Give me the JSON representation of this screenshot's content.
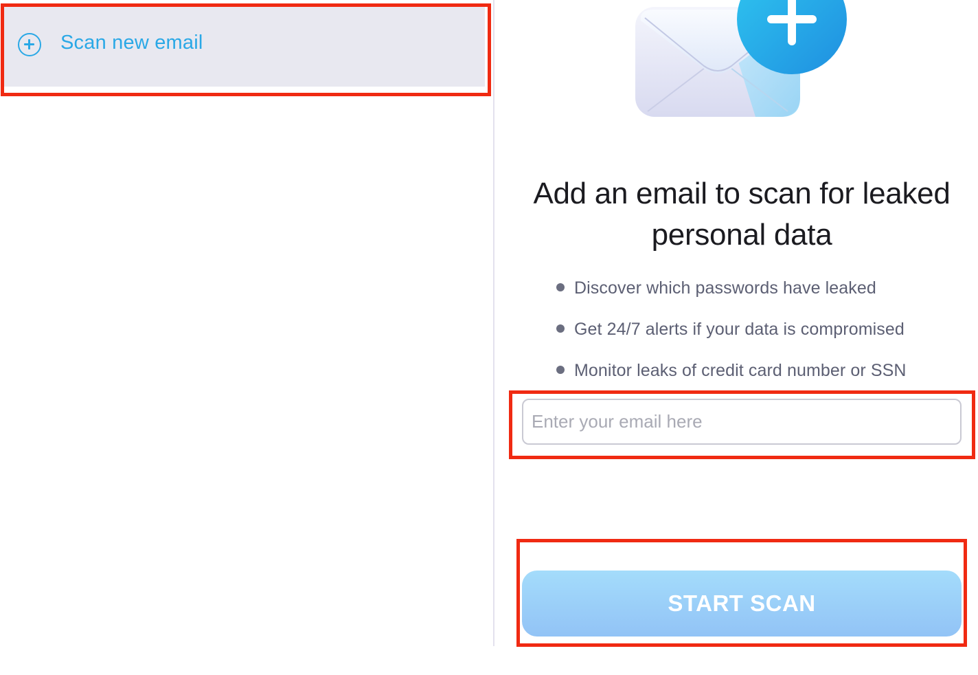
{
  "sidebar": {
    "scan_new": {
      "label": "Scan new email",
      "icon": "plus-circle-icon",
      "color": "#2aa8e6"
    }
  },
  "main": {
    "hero_icon": "email-add-icon",
    "title_line1": "Add an email to scan for leaked",
    "title_line2": "personal data",
    "features": [
      "Discover which passwords have leaked",
      "Get 24/7 alerts if your data is compromised",
      "Monitor leaks of credit card number or SSN"
    ],
    "email_input": {
      "value": "",
      "placeholder": "Enter your email here"
    },
    "start_button": {
      "label": "START SCAN"
    }
  },
  "colors": {
    "accent": "#2aa8e6",
    "highlight": "#f02a12",
    "button_gradient_top": "#a4dcfb",
    "button_gradient_bottom": "#92c3f6"
  }
}
